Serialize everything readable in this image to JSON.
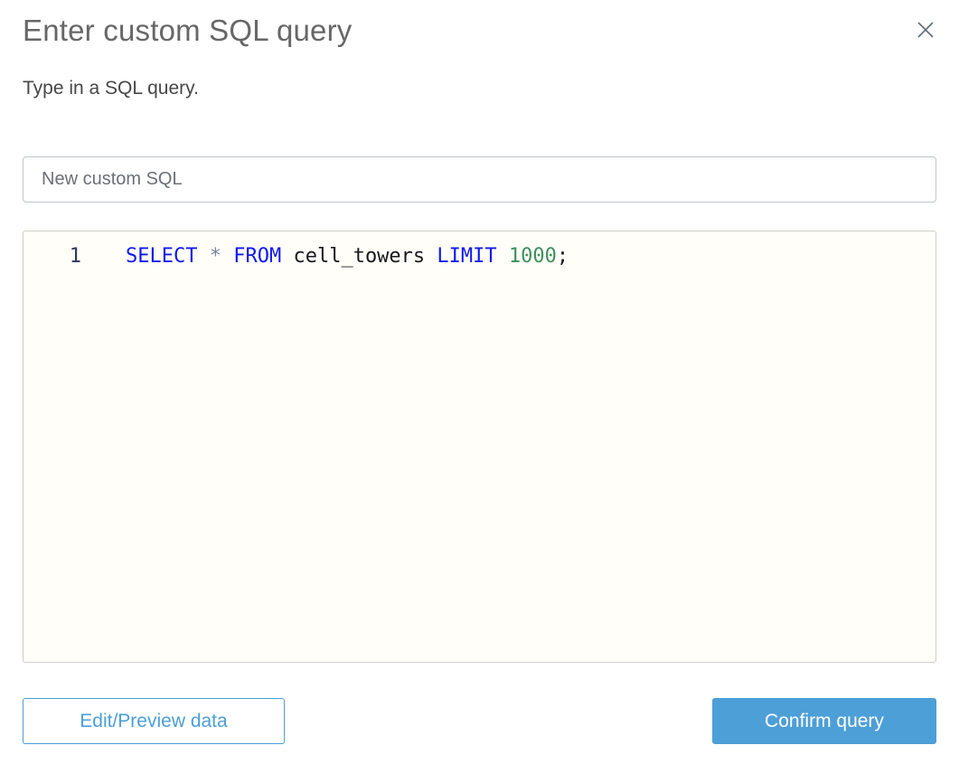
{
  "dialog": {
    "title": "Enter custom SQL query",
    "subtitle": "Type in a SQL query."
  },
  "name_input": {
    "value": "New custom SQL"
  },
  "sql_editor": {
    "lines": [
      {
        "number": "1",
        "tokens": [
          {
            "text": "SELECT",
            "type": "keyword"
          },
          {
            "text": " ",
            "type": "plain"
          },
          {
            "text": "*",
            "type": "operator"
          },
          {
            "text": " ",
            "type": "plain"
          },
          {
            "text": "FROM",
            "type": "keyword"
          },
          {
            "text": " ",
            "type": "plain"
          },
          {
            "text": "cell_towers",
            "type": "identifier"
          },
          {
            "text": " ",
            "type": "plain"
          },
          {
            "text": "LIMIT",
            "type": "keyword"
          },
          {
            "text": " ",
            "type": "plain"
          },
          {
            "text": "1000",
            "type": "number"
          },
          {
            "text": ";",
            "type": "plain"
          }
        ]
      }
    ],
    "colors": {
      "keyword": "#0d18f0",
      "operator": "#7a869d",
      "identifier": "#17191c",
      "number": "#3f8f5f",
      "plain": "#17191c",
      "line_number": "#2e3a59",
      "background": "#fffef8"
    }
  },
  "footer": {
    "secondary_button_label": "Edit/Preview data",
    "primary_button_label": "Confirm query"
  },
  "colors": {
    "accent_blue": "#4b9fd8",
    "title_gray": "#676767",
    "close_icon_gray": "#5f6b7a"
  }
}
